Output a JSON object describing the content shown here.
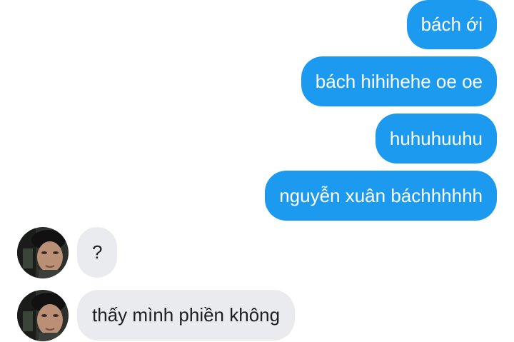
{
  "conversation": {
    "outgoing": [
      "bách ới",
      "bách hihihehe oe oe",
      "huhuhuuhu",
      "nguyễn xuân báchhhhhh"
    ],
    "incoming": [
      "?",
      "thấy mình phiền không"
    ]
  },
  "colors": {
    "outgoing_bubble": "#1b9af0",
    "incoming_bubble": "#e9ebee"
  },
  "icons": {
    "avatar": "profile-photo"
  }
}
